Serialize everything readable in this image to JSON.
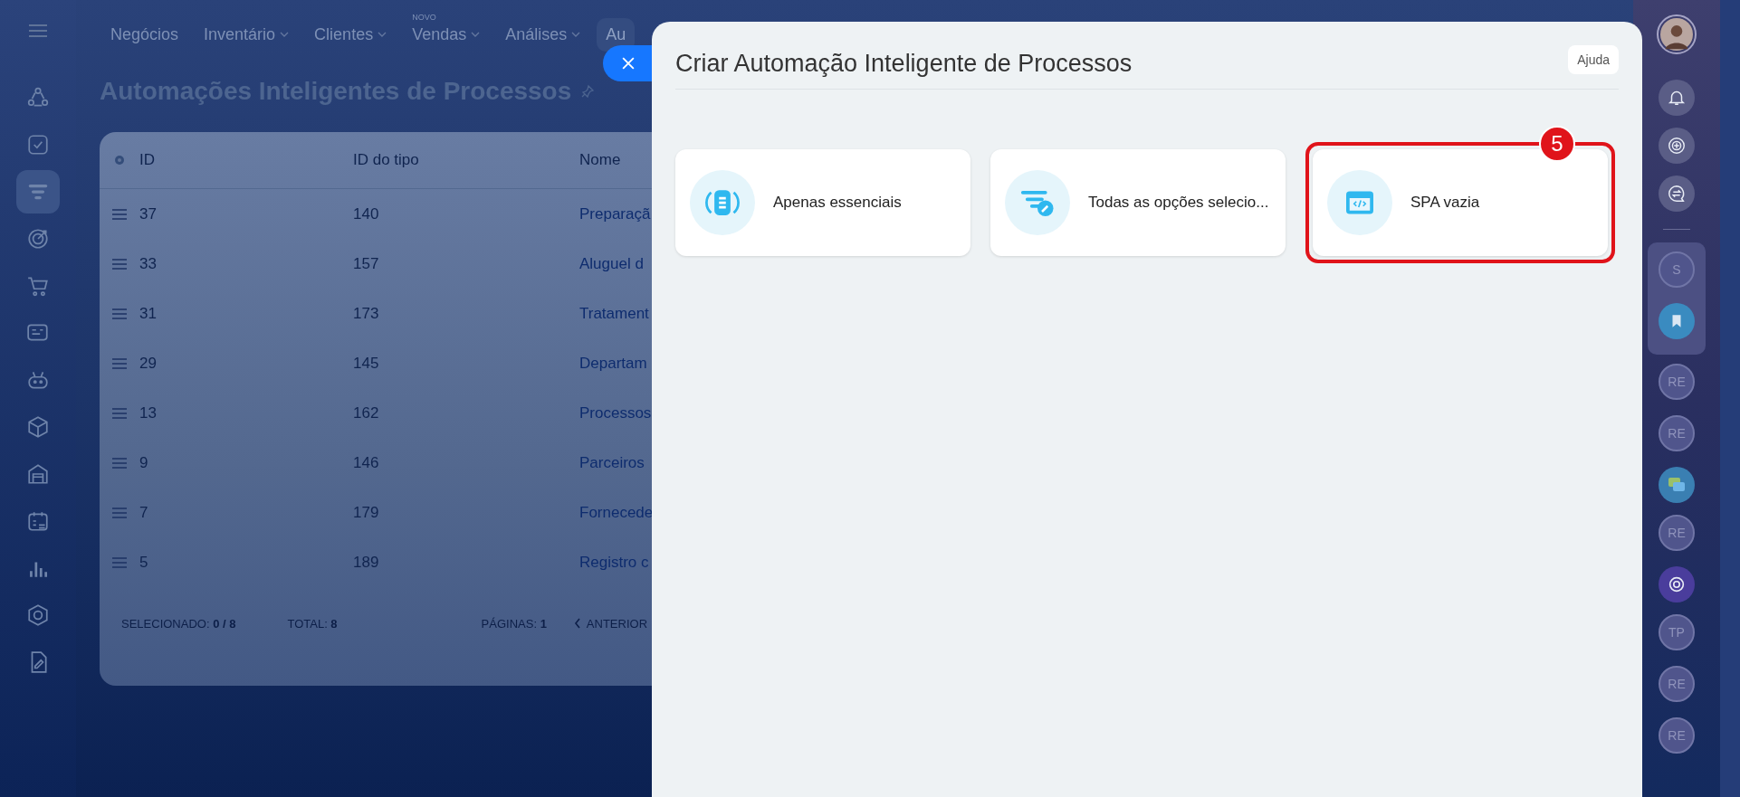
{
  "nav": {
    "items": [
      {
        "label": "Negócios",
        "dropdown": false,
        "selected": false
      },
      {
        "label": "Inventário",
        "dropdown": true,
        "selected": false
      },
      {
        "label": "Clientes",
        "dropdown": true,
        "selected": false
      },
      {
        "label": "Vendas",
        "dropdown": true,
        "selected": false,
        "badge": "NOVO"
      },
      {
        "label": "Análises",
        "dropdown": true,
        "selected": false
      },
      {
        "label": "Au",
        "dropdown": false,
        "selected": true
      }
    ]
  },
  "sidebar": {
    "items": [
      {
        "selected": false
      },
      {
        "selected": false
      },
      {
        "selected": true
      },
      {
        "selected": false
      },
      {
        "selected": false
      },
      {
        "selected": false
      },
      {
        "selected": false
      },
      {
        "selected": false
      },
      {
        "selected": false
      },
      {
        "selected": false
      },
      {
        "selected": false
      },
      {
        "selected": false
      },
      {
        "selected": false
      }
    ]
  },
  "page": {
    "title": "Automações Inteligentes de Processos"
  },
  "table": {
    "columns": [
      "ID",
      "ID do tipo",
      "Nome"
    ],
    "rows": [
      [
        "37",
        "140",
        "Preparaçã"
      ],
      [
        "33",
        "157",
        "Aluguel d"
      ],
      [
        "31",
        "173",
        "Tratament"
      ],
      [
        "29",
        "145",
        "Departam"
      ],
      [
        "13",
        "162",
        "Processos"
      ],
      [
        "9",
        "146",
        "Parceiros"
      ],
      [
        "7",
        "179",
        "Fornecede"
      ],
      [
        "5",
        "189",
        "Registro c"
      ]
    ],
    "footer": {
      "selected_label": "SELECIONADO:",
      "selected_value": "0 / 8",
      "total_label": "TOTAL:",
      "total_value": "8",
      "pages_label": "PÁGINAS:",
      "pages_value": "1",
      "prev": "ANTERIOR"
    }
  },
  "modal": {
    "title": "Criar Automação Inteligente de Processos",
    "help": "Ajuda",
    "cards": [
      {
        "label": "Apenas essenciais",
        "highlighted": false
      },
      {
        "label": "Todas as opções selecio...",
        "highlighted": false
      },
      {
        "label": "SPA vazia",
        "highlighted": true,
        "badge": "5"
      }
    ]
  },
  "right_bar": {
    "items": [
      {
        "kind": "user"
      },
      {
        "kind": "bell"
      },
      {
        "kind": "copilot"
      },
      {
        "kind": "chat"
      },
      {
        "kind": "divider"
      },
      {
        "kind": "initials",
        "text": "S",
        "grouped": true
      },
      {
        "kind": "bookmark",
        "grouped": true
      },
      {
        "kind": "initials",
        "text": "RE"
      },
      {
        "kind": "initials",
        "text": "RE"
      },
      {
        "kind": "messages"
      },
      {
        "kind": "initials",
        "text": "RE"
      },
      {
        "kind": "copilot-color"
      },
      {
        "kind": "initials",
        "text": "TP"
      },
      {
        "kind": "initials",
        "text": "RE"
      },
      {
        "kind": "initials",
        "text": "RE"
      }
    ]
  }
}
